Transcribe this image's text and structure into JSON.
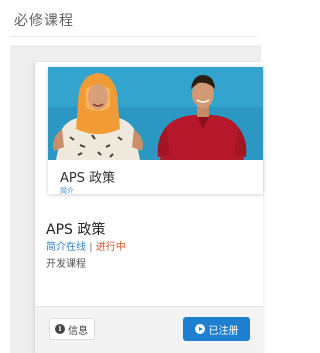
{
  "section": {
    "title": "必修课程"
  },
  "course": {
    "thumbnail_title": "APS 政策",
    "thumbnail_subtitle": "简介",
    "title": "APS 政策",
    "status_online": "简介在线",
    "status_separator": "|",
    "status_progress": "进行中",
    "type": "开发课程",
    "image_icon": "course-thumbnail-people"
  },
  "actions": {
    "info_label": "信息",
    "info_icon": "info-icon",
    "register_label": "已注册",
    "register_icon": "play-circle-icon"
  },
  "colors": {
    "accent": "#1e7fd0",
    "status_progress": "#d2542c",
    "thumbnail_bg": "#2a98c2"
  }
}
